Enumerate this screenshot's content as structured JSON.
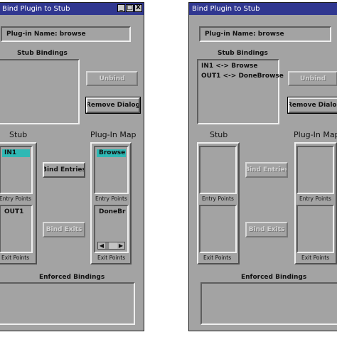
{
  "windows": [
    {
      "title": "Bind Plugin to Stub",
      "title_buttons": [
        "_",
        "□",
        "X"
      ],
      "plugin_name": "Plug-in Name: browse",
      "stub_bindings_label": "Stub Bindings",
      "stub_bindings": [
        "",
        ""
      ],
      "unbind_label": "Unbind",
      "remove_dialog_label": "Remove Dialog",
      "stub_label": "Stub",
      "plugin_map_label": "Plug-In Map",
      "stub_entry": "IN1",
      "stub_exit": "OUT1",
      "plugin_entry": "Browse",
      "plugin_exit": "DoneBrow",
      "entry_points_label": "Entry Points",
      "exit_points_label": "Exit Points",
      "bind_entries_label": "Bind Entries",
      "bind_exits_label": "Bind Exits",
      "enforced_bindings_label": "Enforced Bindings"
    },
    {
      "title": "Bind Plugin to Stub",
      "title_buttons": [],
      "plugin_name": "Plug-in Name: browse",
      "stub_bindings_label": "Stub Bindings",
      "stub_bindings": [
        "IN1 <-> Browse",
        "OUT1 <-> DoneBrowse"
      ],
      "unbind_label": "Unbind",
      "remove_dialog_label": "Remove Dialog",
      "stub_label": "Stub",
      "plugin_map_label": "Plug-In Map",
      "stub_entry": "",
      "stub_exit": "",
      "plugin_entry": "",
      "plugin_exit": "",
      "entry_points_label": "Entry Points",
      "exit_points_label": "Exit Points",
      "bind_entries_label": "Bind Entries",
      "bind_exits_label": "Bind Exits",
      "enforced_bindings_label": "Enforced Bindings"
    }
  ],
  "colors": {
    "titlebar": "#303790",
    "window_bg": "#a3a3a3",
    "selection": "#2fb8b4"
  }
}
